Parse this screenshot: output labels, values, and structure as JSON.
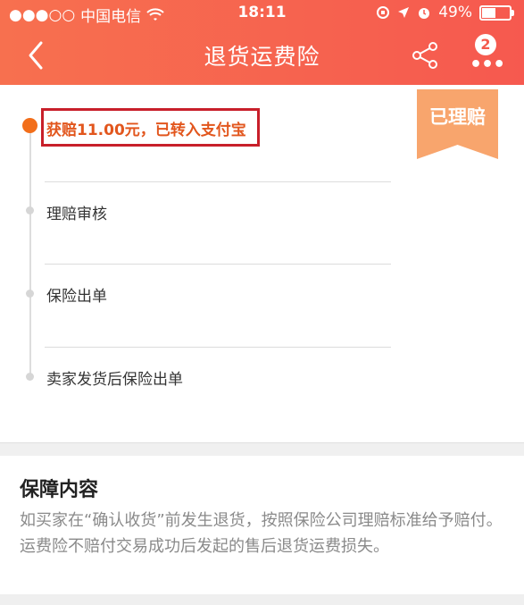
{
  "status_bar": {
    "signal": "●●●○○",
    "carrier": "中国电信",
    "time": "18:11",
    "battery_percent": "49%"
  },
  "nav": {
    "title": "退货运费险",
    "badge_count": "2",
    "more_label": "•••"
  },
  "timeline": {
    "steps": [
      {
        "label": "获赔11.00元，已转入支付宝",
        "active": true
      },
      {
        "label": "理赔审核",
        "active": false
      },
      {
        "label": "保险出单",
        "active": false
      },
      {
        "label": "卖家发货后保险出单",
        "active": false
      }
    ]
  },
  "ribbon": {
    "label": "已理赔"
  },
  "coverage": {
    "title": "保障内容",
    "body": "如买家在“确认收货”前发生退货，按照保险公司理赔标准给予赔付。运费险不赔付交易成功后发起的售后退货运费损失。"
  },
  "colors": {
    "header_gradient_start": "#f7704f",
    "header_gradient_end": "#f6594f",
    "accent_orange": "#f26e1a",
    "ribbon": "#f8a56d",
    "highlight_box": "#c81f2a"
  }
}
